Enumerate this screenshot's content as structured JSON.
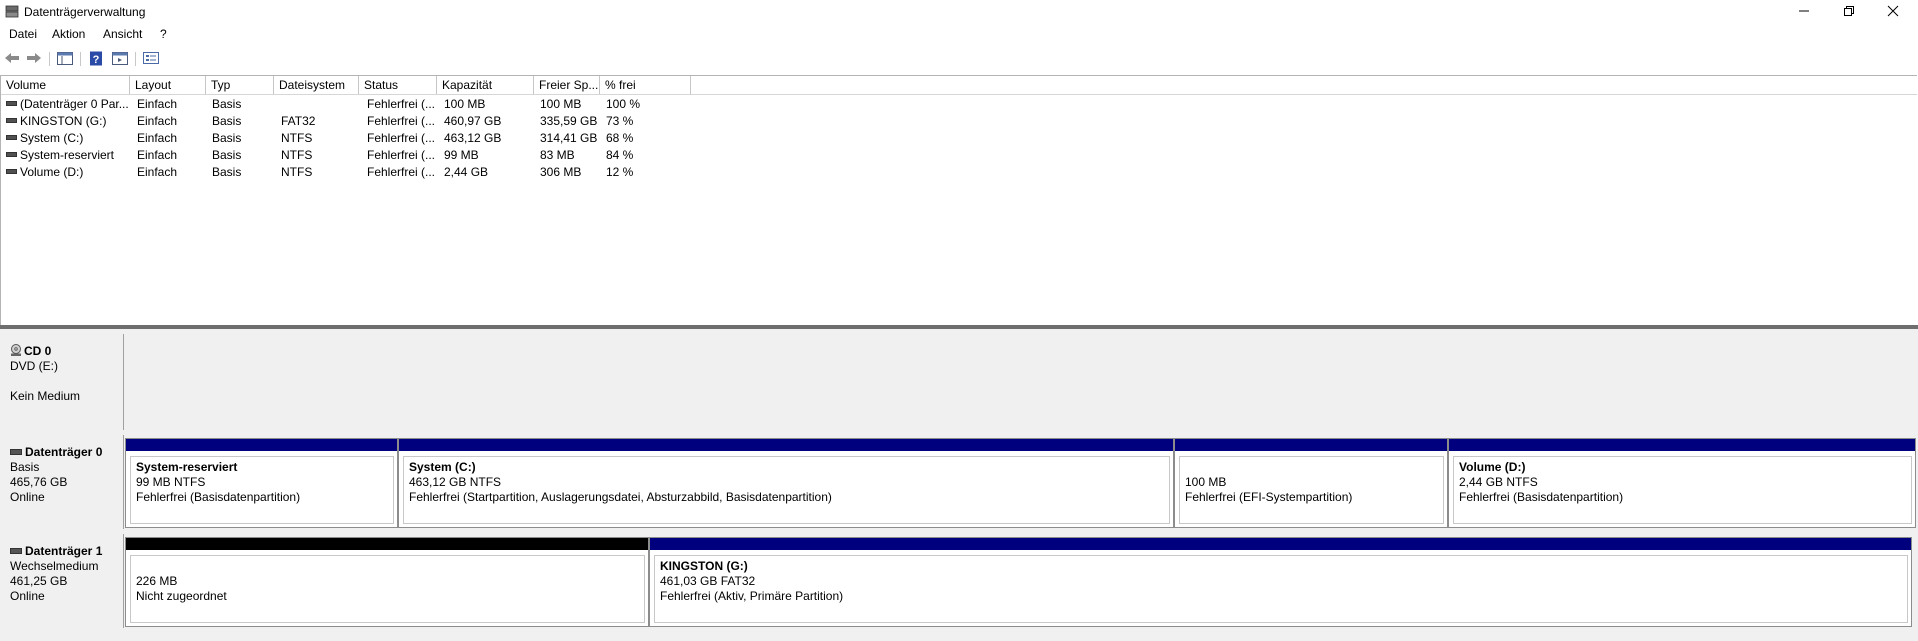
{
  "window": {
    "title": "Datenträgerverwaltung"
  },
  "menu": [
    "Datei",
    "Aktion",
    "Ansicht",
    "?"
  ],
  "toolbar": {
    "icons": [
      "back-arrow-icon",
      "forward-arrow-icon",
      "console-tree-icon",
      "help-icon",
      "action-pane-icon",
      "properties-icon"
    ]
  },
  "volume_list": {
    "columns": [
      "Volume",
      "Layout",
      "Typ",
      "Dateisystem",
      "Status",
      "Kapazität",
      "Freier Sp...",
      "% frei"
    ],
    "rows": [
      [
        "(Datenträger 0 Par...",
        "Einfach",
        "Basis",
        "",
        "Fehlerfrei (...",
        "100 MB",
        "100 MB",
        "100 %"
      ],
      [
        "KINGSTON (G:)",
        "Einfach",
        "Basis",
        "FAT32",
        "Fehlerfrei (...",
        "460,97 GB",
        "335,59 GB",
        "73 %"
      ],
      [
        "System (C:)",
        "Einfach",
        "Basis",
        "NTFS",
        "Fehlerfrei (...",
        "463,12 GB",
        "314,41 GB",
        "68 %"
      ],
      [
        "System-reserviert",
        "Einfach",
        "Basis",
        "NTFS",
        "Fehlerfrei (...",
        "99 MB",
        "83 MB",
        "84 %"
      ],
      [
        "Volume (D:)",
        "Einfach",
        "Basis",
        "NTFS",
        "Fehlerfrei (...",
        "2,44 GB",
        "306 MB",
        "12 %"
      ]
    ]
  },
  "disks": {
    "cd0": {
      "name": "CD 0",
      "line1": "DVD (E:)",
      "line2": "Kein Medium"
    },
    "disk0": {
      "name": "Datenträger 0",
      "type": "Basis",
      "size": "465,76 GB",
      "status": "Online",
      "partitions": [
        {
          "title": "System-reserviert",
          "size": "99 MB NTFS",
          "status": "Fehlerfrei (Basisdatenpartition)"
        },
        {
          "title": "System  (C:)",
          "size": "463,12 GB NTFS",
          "status": "Fehlerfrei (Startpartition, Auslagerungsdatei, Absturzabbild, Basisdatenpartition)"
        },
        {
          "title": "",
          "size": "100 MB",
          "status": "Fehlerfrei (EFI-Systempartition)"
        },
        {
          "title": "Volume  (D:)",
          "size": "2,44 GB NTFS",
          "status": "Fehlerfrei (Basisdatenpartition)"
        }
      ]
    },
    "disk1": {
      "name": "Datenträger 1",
      "type": "Wechselmedium",
      "size": "461,25 GB",
      "status": "Online",
      "partitions": [
        {
          "title": "",
          "size": "226 MB",
          "status": "Nicht zugeordnet"
        },
        {
          "title": "KINGSTON  (G:)",
          "size": "461,03 GB FAT32",
          "status": "Fehlerfrei (Aktiv, Primäre Partition)"
        }
      ]
    }
  }
}
